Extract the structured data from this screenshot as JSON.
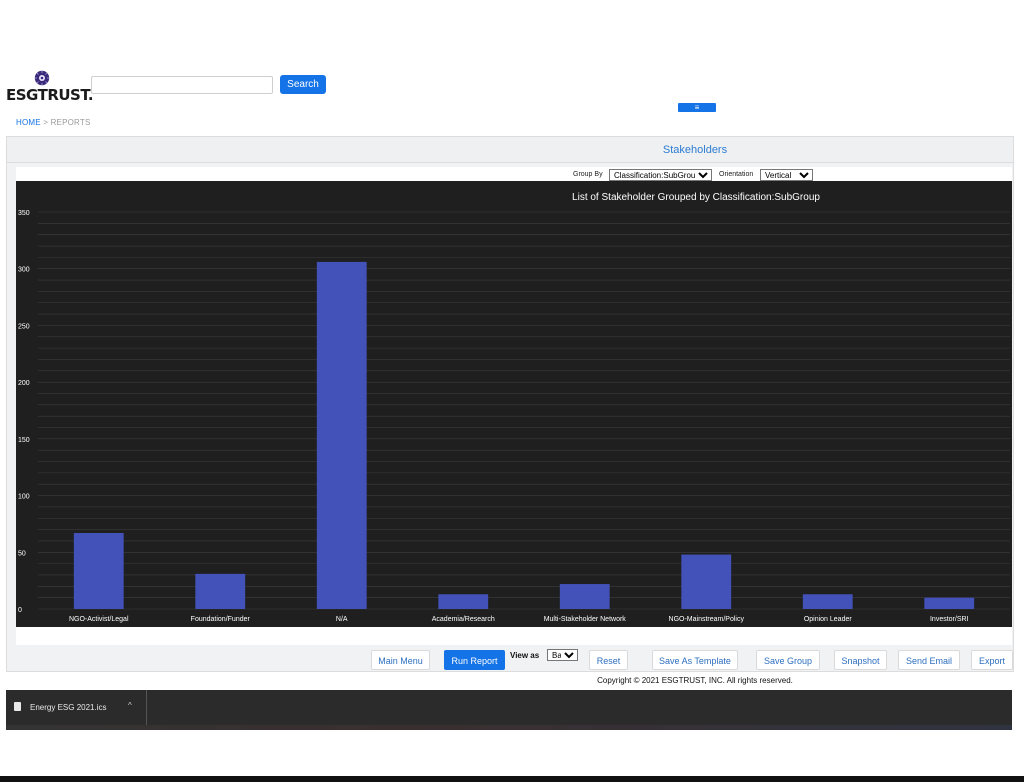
{
  "header": {
    "logo_text": "ESGTRUST.",
    "search_placeholder": "",
    "search_button": "Search",
    "menu_toggle": "≡"
  },
  "breadcrumb": {
    "home": "HOME",
    "separator": ">",
    "current": "REPORTS"
  },
  "panel": {
    "title": "Stakeholders",
    "group_by_label": "Group By",
    "group_by_value": "Classification:SubGroup",
    "orientation_label": "Orientation",
    "orientation_value": "Vertical"
  },
  "chart_data": {
    "type": "bar",
    "title": "List of Stakeholder Grouped by Classification:SubGroup",
    "xlabel": "",
    "ylabel": "",
    "categories": [
      "NGO-Activist/Legal",
      "Foundation/Funder",
      "N/A",
      "Academia/Research",
      "Multi-Stakeholder Network",
      "NGO-Mainstream/Policy",
      "Opinion Leader",
      "Investor/SRI"
    ],
    "values": [
      67,
      31,
      306,
      13,
      22,
      48,
      13,
      10
    ],
    "ylim": [
      0,
      350
    ],
    "yticks": [
      0,
      50,
      100,
      150,
      200,
      250,
      300,
      350
    ],
    "grid": true,
    "colors": {
      "bar": "#4352b8",
      "background": "#1f1f1f",
      "text": "#ffffff",
      "grid": "#3d3d3d"
    }
  },
  "actions": {
    "main_menu": "Main Menu",
    "run_report": "Run Report",
    "view_as_label": "View as",
    "view_as_value": "Bars",
    "reset": "Reset",
    "save_as_template": "Save As Template",
    "save_group": "Save Group",
    "snapshot": "Snapshot",
    "send_email": "Send Email",
    "export": "Export"
  },
  "footer": {
    "copyright": "Copyright © 2021 ESGTRUST, INC. All rights reserved."
  },
  "downloads": {
    "file_name": "Energy ESG 2021.ics",
    "chevron": "^"
  },
  "colors": {
    "accent": "#1473e6",
    "title_blue": "#2d7dd2"
  }
}
